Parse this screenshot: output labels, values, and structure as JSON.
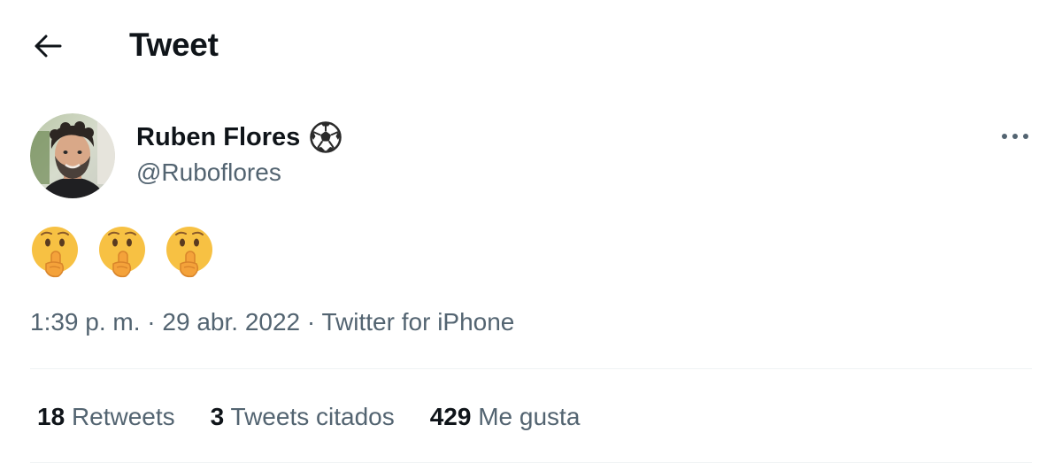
{
  "header": {
    "title": "Tweet",
    "back_icon": "arrow-left-icon"
  },
  "author": {
    "name": "Ruben Flores",
    "badge_icon": "soccer-ball-icon",
    "handle": "@Ruboflores"
  },
  "tweet": {
    "emojis": [
      "shushing-face-emoji",
      "shushing-face-emoji",
      "shushing-face-emoji"
    ]
  },
  "meta": {
    "time": "1:39 p. m.",
    "sep1": " · ",
    "date": "29 abr. 2022",
    "sep2": " · ",
    "source": "Twitter for iPhone"
  },
  "stats": [
    {
      "count": "18",
      "label": "Retweets"
    },
    {
      "count": "3",
      "label": "Tweets citados"
    },
    {
      "count": "429",
      "label": "Me gusta"
    }
  ],
  "colors": {
    "text_primary": "#0f1419",
    "text_secondary": "#536471",
    "divider": "#eff3f4"
  }
}
